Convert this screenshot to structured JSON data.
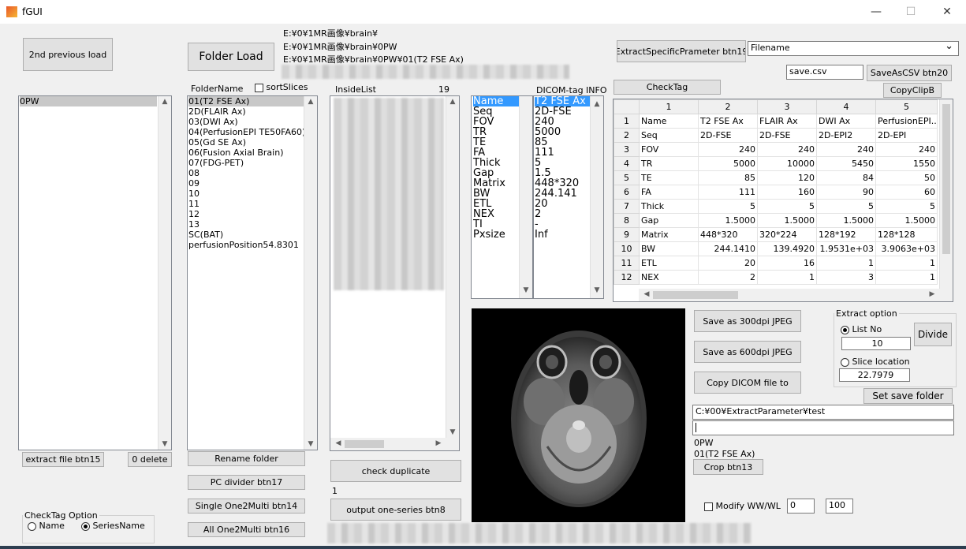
{
  "window": {
    "title": "fGUI",
    "minimize": "—",
    "maximize": "☐",
    "close": "✕"
  },
  "buttons": {
    "second_previous_load": "2nd previous load",
    "folder_load": "Folder Load",
    "extract_file": "extract file btn15",
    "delete": "0 delete",
    "rename_folder": "Rename folder",
    "pc_divider": "PC divider btn17",
    "single_one2multi": "Single One2Multi btn14",
    "all_one2multi": "All One2Multi btn16",
    "check_duplicate": "check duplicate",
    "output_one_series": "output one-series btn8",
    "extract_specific": "ExtractSpecificPrameter btn19",
    "save_as_csv": "SaveAsCSV btn20",
    "check_tag": "CheckTag",
    "copy_clip": "CopyClipB",
    "save_300": "Save as 300dpi JPEG",
    "save_600": "Save as 600dpi JPEG",
    "copy_dicom": "Copy DICOM file to",
    "divide": "Divide",
    "set_save_folder": "Set save folder",
    "crop": "Crop btn13"
  },
  "paths": [
    "E:¥0¥1MR画像¥brain¥",
    "E:¥0¥1MR画像¥brain¥0PW",
    "E:¥0¥1MR画像¥brain¥0PW¥01(T2 FSE Ax)"
  ],
  "left_list": {
    "items": [
      "0PW"
    ],
    "selected": 0
  },
  "folder_panel": {
    "label": "FolderName",
    "sort_label": "sortSlices",
    "items": [
      "01(T2 FSE Ax)",
      "2D(FLAIR Ax)",
      "03(DWI Ax)",
      "04(PerfusionEPI TE50FA60)",
      "05(Gd SE Ax)",
      "06(Fusion Axial Brain)",
      "07(FDG-PET)",
      "08",
      "09",
      "10",
      "11",
      "12",
      "13",
      "SC(BAT)",
      "perfusionPosition54.8301"
    ],
    "selected": 0
  },
  "inside_panel": {
    "label": "InsideList",
    "count": "19",
    "dup_count": "1"
  },
  "dicom": {
    "label": "DICOM-tag INFO",
    "names": [
      "Name",
      "Seq",
      "FOV",
      "TR",
      "TE",
      "FA",
      "Thick",
      "Gap",
      "Matrix",
      "BW",
      "ETL",
      "NEX",
      "TI",
      "Pxsize"
    ],
    "values": [
      "T2 FSE Ax",
      "2D-FSE",
      "240",
      "5000",
      "85",
      "111",
      "5",
      "1.5",
      "448*320",
      "244.141",
      "20",
      "2",
      "-",
      "Inf"
    ]
  },
  "filename_dropdown": {
    "value": "Filename",
    "arrow": "⌄"
  },
  "csv_input": {
    "value": "save.csv"
  },
  "param_table": {
    "col_headers": [
      "1",
      "2",
      "3",
      "4",
      "5"
    ],
    "rows": [
      [
        "1",
        "Name",
        "T2 FSE Ax",
        "FLAIR Ax",
        "DWI Ax",
        "PerfusionEPI..."
      ],
      [
        "2",
        "Seq",
        "2D-FSE",
        "2D-FSE",
        "2D-EPI2",
        "2D-EPI"
      ],
      [
        "3",
        "FOV",
        "240",
        "240",
        "240",
        "240"
      ],
      [
        "4",
        "TR",
        "5000",
        "10000",
        "5450",
        "1550"
      ],
      [
        "5",
        "TE",
        "85",
        "120",
        "84",
        "50"
      ],
      [
        "6",
        "FA",
        "111",
        "160",
        "90",
        "60"
      ],
      [
        "7",
        "Thick",
        "5",
        "5",
        "5",
        "5"
      ],
      [
        "8",
        "Gap",
        "1.5000",
        "1.5000",
        "1.5000",
        "1.5000"
      ],
      [
        "9",
        "Matrix",
        "448*320",
        "320*224",
        "128*192",
        "128*128"
      ],
      [
        "10",
        "BW",
        "244.1410",
        "139.4920",
        "1.9531e+03",
        "3.9063e+03"
      ],
      [
        "11",
        "ETL",
        "20",
        "16",
        "1",
        "1"
      ],
      [
        "12",
        "NEX",
        "2",
        "1",
        "3",
        "1"
      ]
    ]
  },
  "extract_option": {
    "legend": "Extract option",
    "list_no_label": "List No",
    "list_no_value": "10",
    "slice_label": "Slice location",
    "slice_value": "22.7979",
    "selected": "list_no"
  },
  "save_folder_path": "C:¥00¥ExtractParameter¥test",
  "status": {
    "line1": "0PW",
    "line2": "01(T2 FSE Ax)"
  },
  "modify": {
    "label": "Modify WW/WL",
    "ww": "0",
    "wl": "100"
  },
  "checktag_option": {
    "legend": "CheckTag Option",
    "name_label": "Name",
    "series_label": "SeriesName",
    "selected": "SeriesName"
  },
  "scroll_glyphs": {
    "up": "▲",
    "down": "▼",
    "left": "◀",
    "right": "▶"
  }
}
